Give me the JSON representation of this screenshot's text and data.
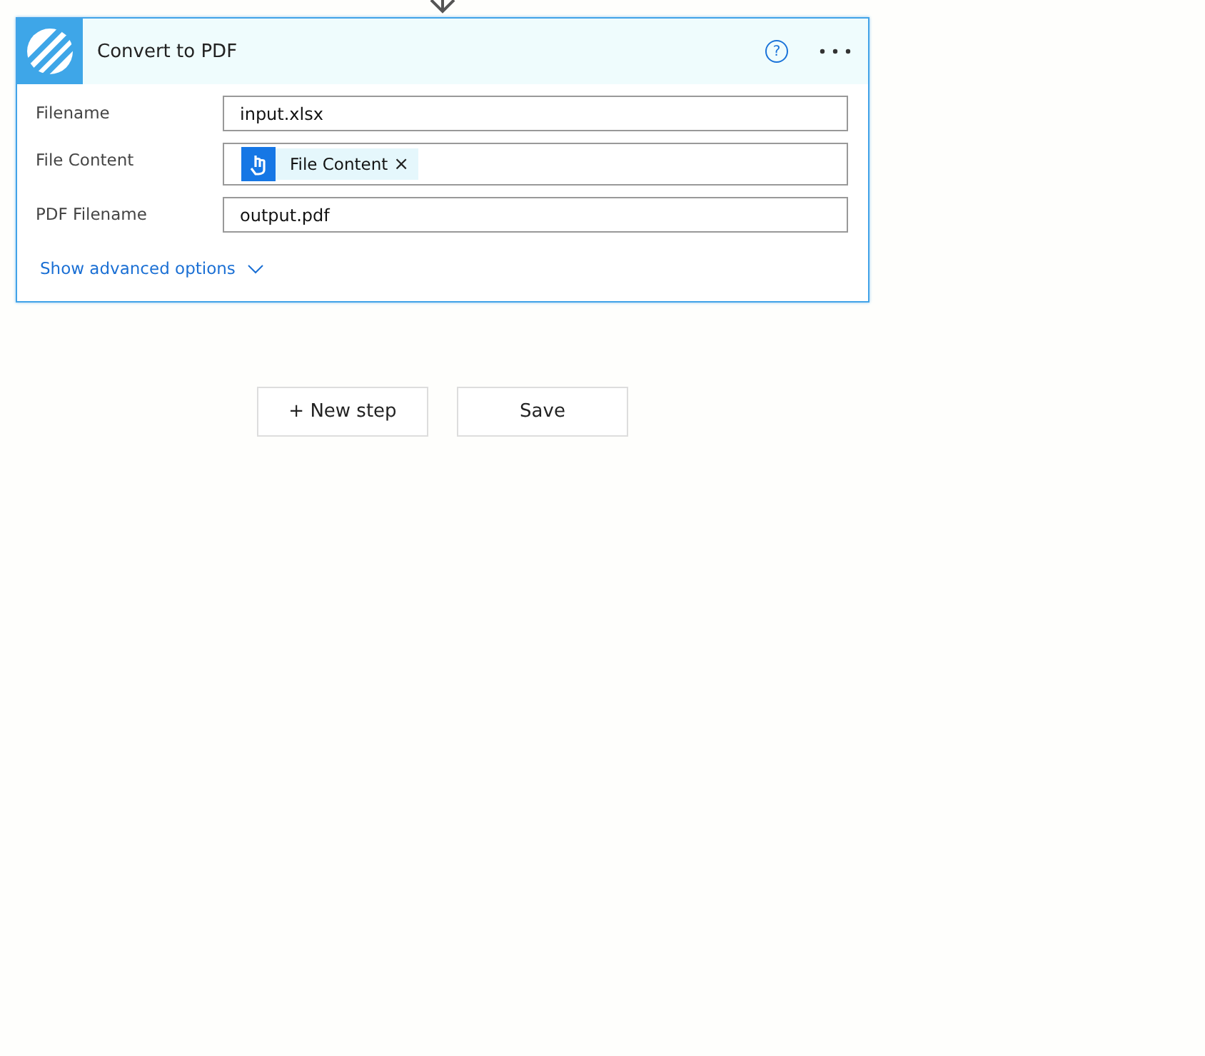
{
  "card": {
    "title": "Convert to PDF",
    "help": "?",
    "fields": [
      {
        "label": "Filename",
        "kind": "text",
        "value": "input.xlsx"
      },
      {
        "label": "File Content",
        "kind": "token",
        "value": "File Content",
        "remove": "×"
      },
      {
        "label": "PDF Filename",
        "kind": "text",
        "value": "output.pdf"
      }
    ],
    "advanced_link": "Show advanced options"
  },
  "buttons": [
    "+ New step",
    "Save"
  ]
}
